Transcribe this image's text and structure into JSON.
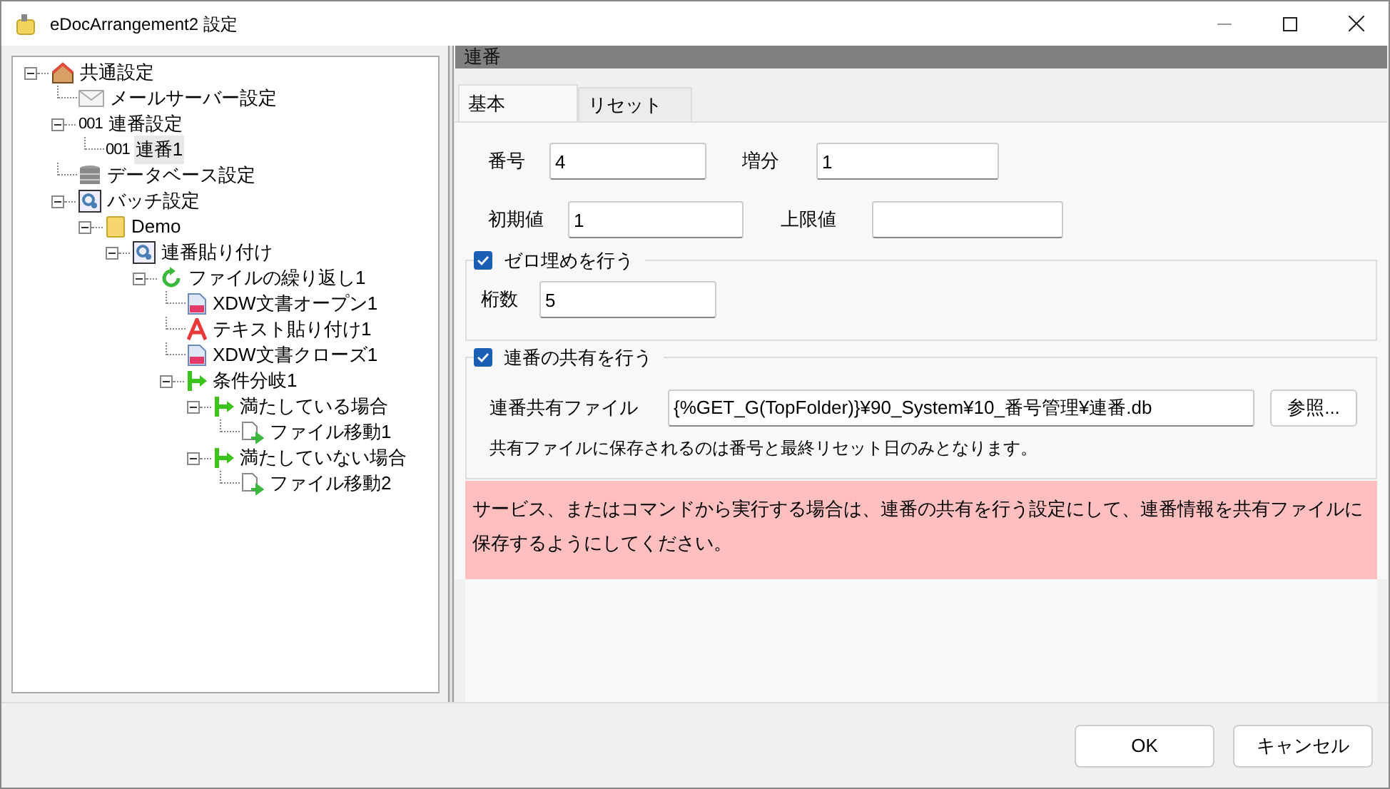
{
  "window": {
    "title": "eDocArrangement2 設定"
  },
  "tree": [
    {
      "label": "共通設定",
      "kind": "house",
      "expanded": true,
      "selected": false,
      "children": [
        {
          "label": "メールサーバー設定",
          "kind": "mail",
          "selected": false
        },
        {
          "label": "連番設定",
          "kind": "counter",
          "prefix": "001",
          "expanded": true,
          "selected": false,
          "children": [
            {
              "label": "連番1",
              "kind": "counter",
              "prefix": "001",
              "selected": true
            }
          ]
        },
        {
          "label": "データベース設定",
          "kind": "database",
          "selected": false
        },
        {
          "label": "バッチ設定",
          "kind": "batch",
          "expanded": true,
          "selected": false,
          "children": [
            {
              "label": "Demo",
              "kind": "folder",
              "expanded": true,
              "selected": false,
              "children": [
                {
                  "label": "連番貼り付け",
                  "kind": "batch",
                  "expanded": true,
                  "selected": false,
                  "children": [
                    {
                      "label": "ファイルの繰り返し1",
                      "kind": "loop",
                      "expanded": true,
                      "selected": false,
                      "children": [
                        {
                          "label": "XDW文書オープン1",
                          "kind": "document",
                          "selected": false
                        },
                        {
                          "label": "テキスト貼り付け1",
                          "kind": "letter",
                          "selected": false
                        },
                        {
                          "label": "XDW文書クローズ1",
                          "kind": "document",
                          "selected": false
                        },
                        {
                          "label": "条件分岐1",
                          "kind": "branch",
                          "expanded": true,
                          "selected": false,
                          "children": [
                            {
                              "label": "満たしている場合",
                              "kind": "branch",
                              "expanded": true,
                              "selected": false,
                              "children": [
                                {
                                  "label": "ファイル移動1",
                                  "kind": "filemove",
                                  "selected": false
                                }
                              ]
                            },
                            {
                              "label": "満たしていない場合",
                              "kind": "branch",
                              "expanded": true,
                              "selected": false,
                              "children": [
                                {
                                  "label": "ファイル移動2",
                                  "kind": "filemove",
                                  "selected": false
                                }
                              ]
                            }
                          ]
                        }
                      ]
                    }
                  ]
                }
              ]
            }
          ]
        }
      ]
    }
  ],
  "panel": {
    "header": "連番",
    "tabs": [
      {
        "label": "基本",
        "selected": true
      },
      {
        "label": "リセット",
        "selected": false
      }
    ],
    "number": {
      "label": "番号",
      "value": "4"
    },
    "increment": {
      "label": "増分",
      "value": "1"
    },
    "initial": {
      "label": "初期値",
      "value": "1"
    },
    "max": {
      "label": "上限値"
    },
    "zero_pad": {
      "label": "ゼロ埋めを行う",
      "checked": true,
      "digits_label": "桁数",
      "digits_value": "5"
    },
    "share": {
      "label": "連番の共有を行う",
      "checked": true,
      "file_label": "連番共有ファイル",
      "file_value": "{%GET_G(TopFolder)}¥90_System¥10_番号管理¥連番.db",
      "browse": "参照...",
      "note": "共有ファイルに保存されるのは番号と最終リセット日のみとなります。"
    },
    "warning": "サービス、またはコマンドから実行する場合は、連番の共有を行う設定にして、連番情報を共有ファイルに保存するようにしてください。"
  },
  "buttons": [
    "OK",
    "キャンセル"
  ]
}
